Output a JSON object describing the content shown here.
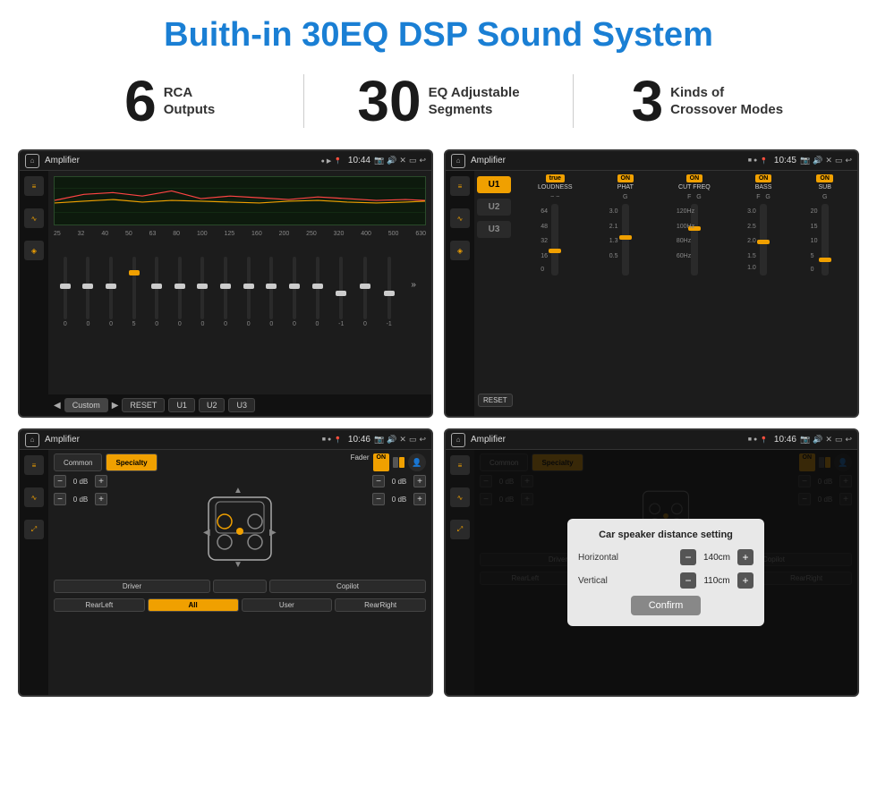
{
  "header": {
    "title": "Buith-in 30EQ DSP Sound System"
  },
  "stats": [
    {
      "number": "6",
      "line1": "RCA",
      "line2": "Outputs"
    },
    {
      "number": "30",
      "line1": "EQ Adjustable",
      "line2": "Segments"
    },
    {
      "number": "3",
      "line1": "Kinds of",
      "line2": "Crossover Modes"
    }
  ],
  "screens": [
    {
      "id": "screen1",
      "title": "Amplifier",
      "time": "10:44",
      "type": "eq",
      "labels": [
        "25",
        "32",
        "40",
        "50",
        "63",
        "80",
        "100",
        "125",
        "160",
        "200",
        "250",
        "320",
        "400",
        "500",
        "630"
      ],
      "values": [
        "0",
        "0",
        "0",
        "5",
        "0",
        "0",
        "0",
        "0",
        "0",
        "0",
        "0",
        "0",
        "-1",
        "0",
        "-1"
      ],
      "bottomBtns": [
        "Custom",
        "RESET",
        "U1",
        "U2",
        "U3"
      ]
    },
    {
      "id": "screen2",
      "title": "Amplifier",
      "time": "10:45",
      "type": "amp",
      "uBtns": [
        "U1",
        "U2",
        "U3"
      ],
      "activeU": "U1",
      "controls": [
        {
          "on": true,
          "label": "LOUDNESS"
        },
        {
          "on": true,
          "label": "PHAT"
        },
        {
          "on": true,
          "label": "CUT FREQ"
        },
        {
          "on": true,
          "label": "BASS"
        },
        {
          "on": true,
          "label": "SUB"
        }
      ],
      "resetBtn": "RESET"
    },
    {
      "id": "screen3",
      "title": "Amplifier",
      "time": "10:46",
      "type": "fader",
      "tabs": [
        "Common",
        "Specialty"
      ],
      "activeTab": "Specialty",
      "faderLabel": "Fader",
      "faderOn": "ON",
      "volumes": [
        "0 dB",
        "0 dB",
        "0 dB",
        "0 dB"
      ],
      "positions": [
        "Driver",
        "Copilot",
        "RearLeft",
        "RearRight"
      ],
      "allBtn": "All",
      "userBtn": "User"
    },
    {
      "id": "screen4",
      "title": "Amplifier",
      "time": "10:46",
      "type": "dialog",
      "tabs": [
        "Common",
        "Specialty"
      ],
      "dialogTitle": "Car speaker distance setting",
      "horizontal": {
        "label": "Horizontal",
        "value": "140cm"
      },
      "vertical": {
        "label": "Vertical",
        "value": "110cm"
      },
      "confirmBtn": "Confirm",
      "volumes": [
        "0 dB",
        "0 dB"
      ],
      "positions": [
        "Driver",
        "Copilot",
        "RearLeft",
        "RearRight"
      ]
    }
  ],
  "icons": {
    "home": "⌂",
    "play": "▶",
    "pause": "⏸",
    "back": "↩",
    "settings": "⚙",
    "music": "♪",
    "speaker": "◈",
    "minus": "−",
    "plus": "+"
  }
}
